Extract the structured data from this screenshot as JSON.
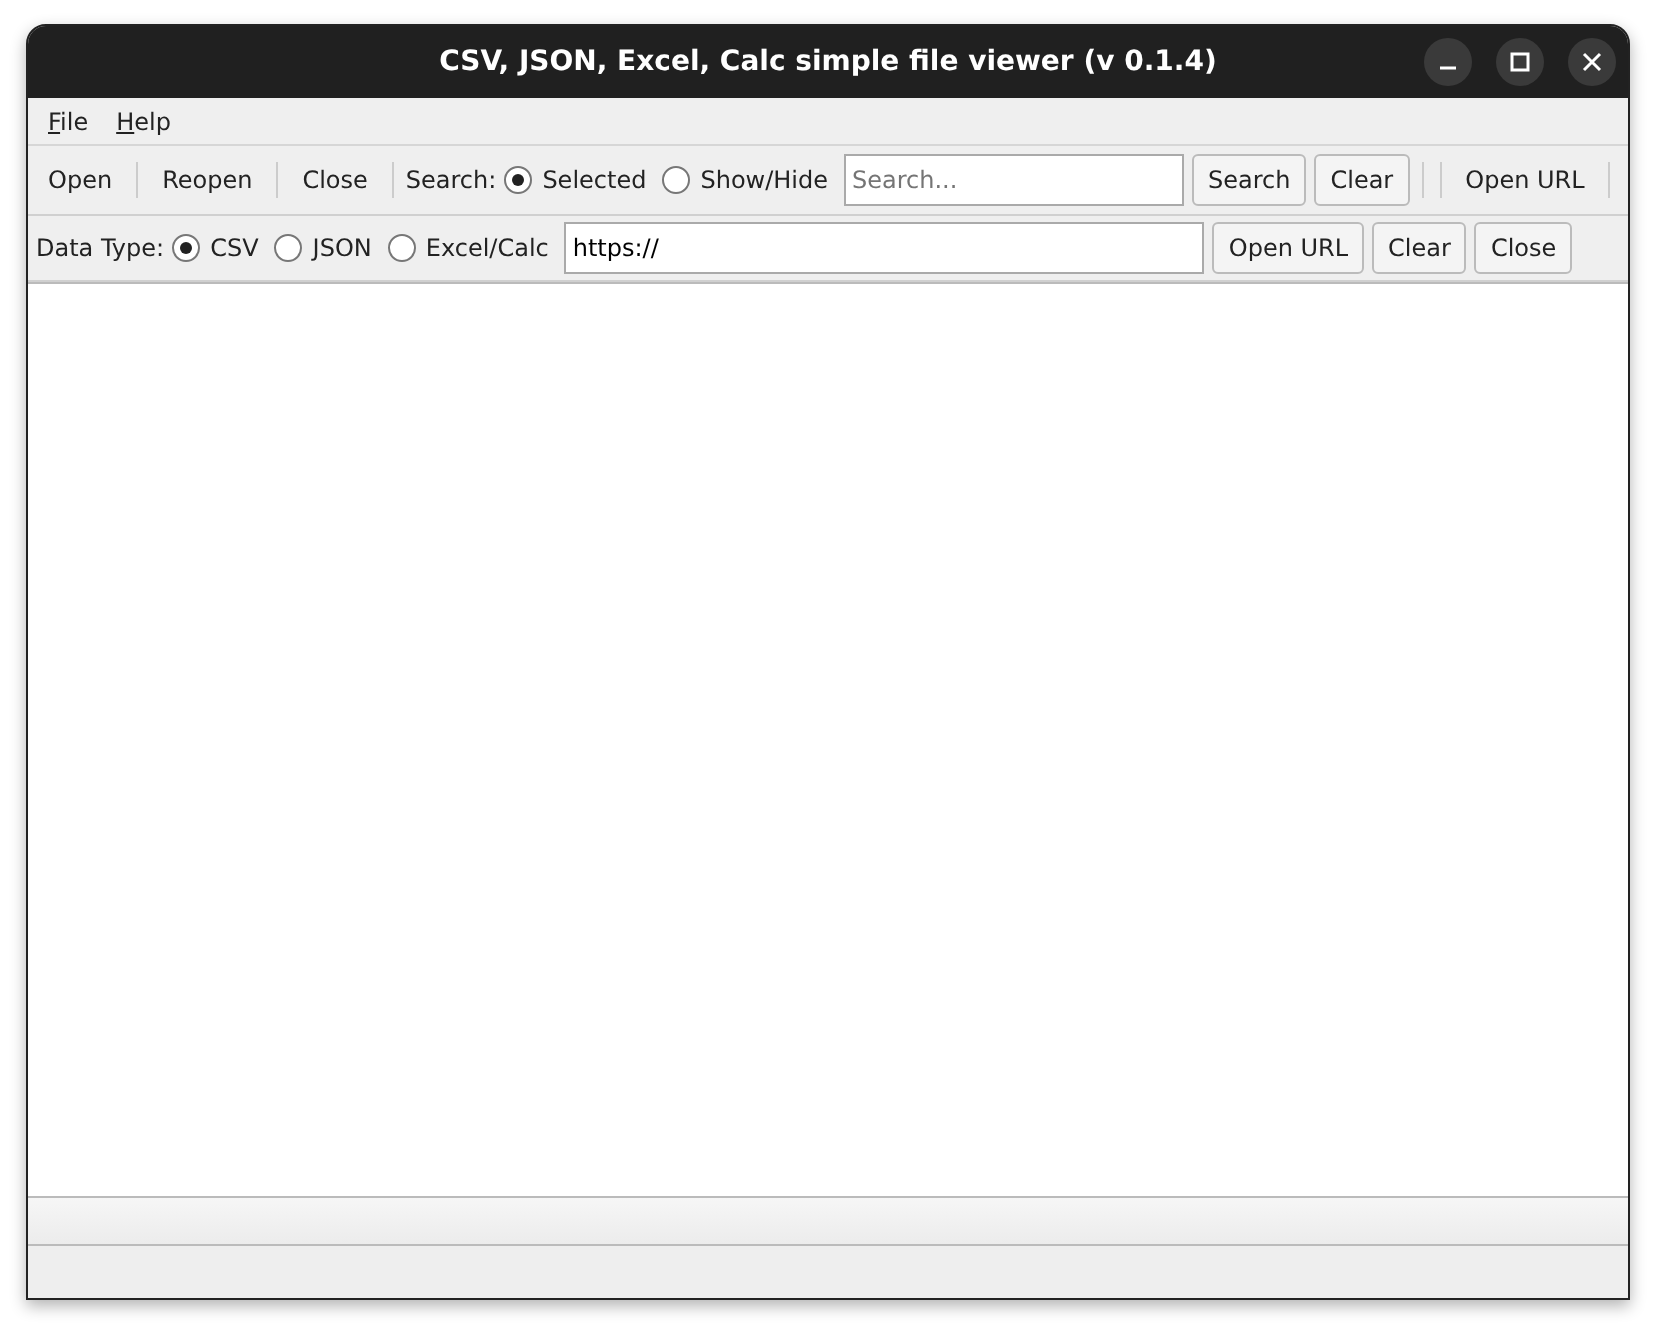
{
  "window": {
    "title": "CSV, JSON, Excel, Calc simple file viewer (v 0.1.4)"
  },
  "menu": [
    "File",
    "Help"
  ],
  "toolbar": {
    "buttons_left": [
      "Open",
      "Reopen",
      "Close"
    ],
    "search_label": "Search:",
    "search_modes": [
      {
        "label": "Selected",
        "selected": true
      },
      {
        "label": "Show/Hide",
        "selected": false
      }
    ],
    "search_field": {
      "placeholder": "Search..."
    },
    "search_buttons": [
      "Search",
      "Clear"
    ],
    "open_url": "Open URL"
  },
  "url_bar": {
    "label": "Data Type:",
    "data_types": [
      {
        "label": "CSV",
        "selected": true
      },
      {
        "label": "JSON",
        "selected": false
      },
      {
        "label": "Excel/Calc",
        "selected": false
      }
    ],
    "url_field": {
      "value": "https://"
    },
    "buttons": [
      "Open URL",
      "Clear",
      "Close"
    ]
  }
}
